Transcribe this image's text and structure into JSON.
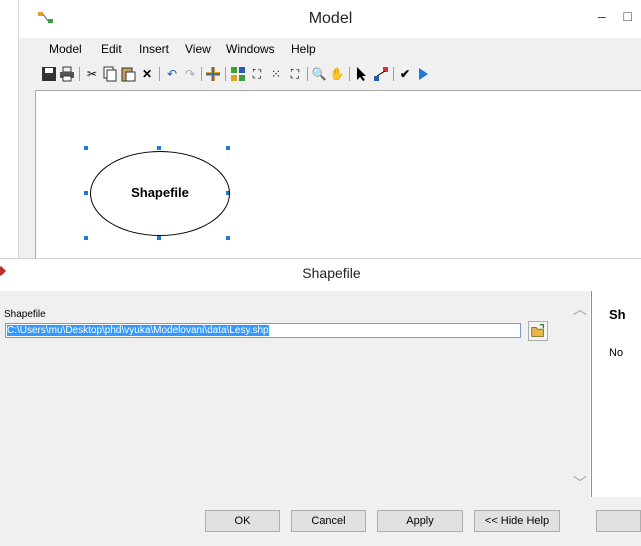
{
  "model_window": {
    "title": "Model",
    "window_controls": {
      "minimize": "–",
      "maximize": "□"
    },
    "menu": [
      "Model",
      "Edit",
      "Insert",
      "View",
      "Windows",
      "Help"
    ],
    "canvas": {
      "element_label": "Shapefile"
    }
  },
  "dialog": {
    "title": "Shapefile",
    "field_label": "Shapefile",
    "field_value": "C:\\Users\\mu\\Desktop\\phd\\vyuka\\Modelovani\\data\\Lesy.shp",
    "help_heading": "Sh",
    "help_text": "No",
    "buttons": {
      "ok": "OK",
      "cancel": "Cancel",
      "apply": "Apply",
      "hide_help": "<< Hide Help"
    }
  },
  "colors": {
    "selection": "#3399ff",
    "handle": "#1e78d7",
    "run_arrow": "#1e78d7"
  }
}
